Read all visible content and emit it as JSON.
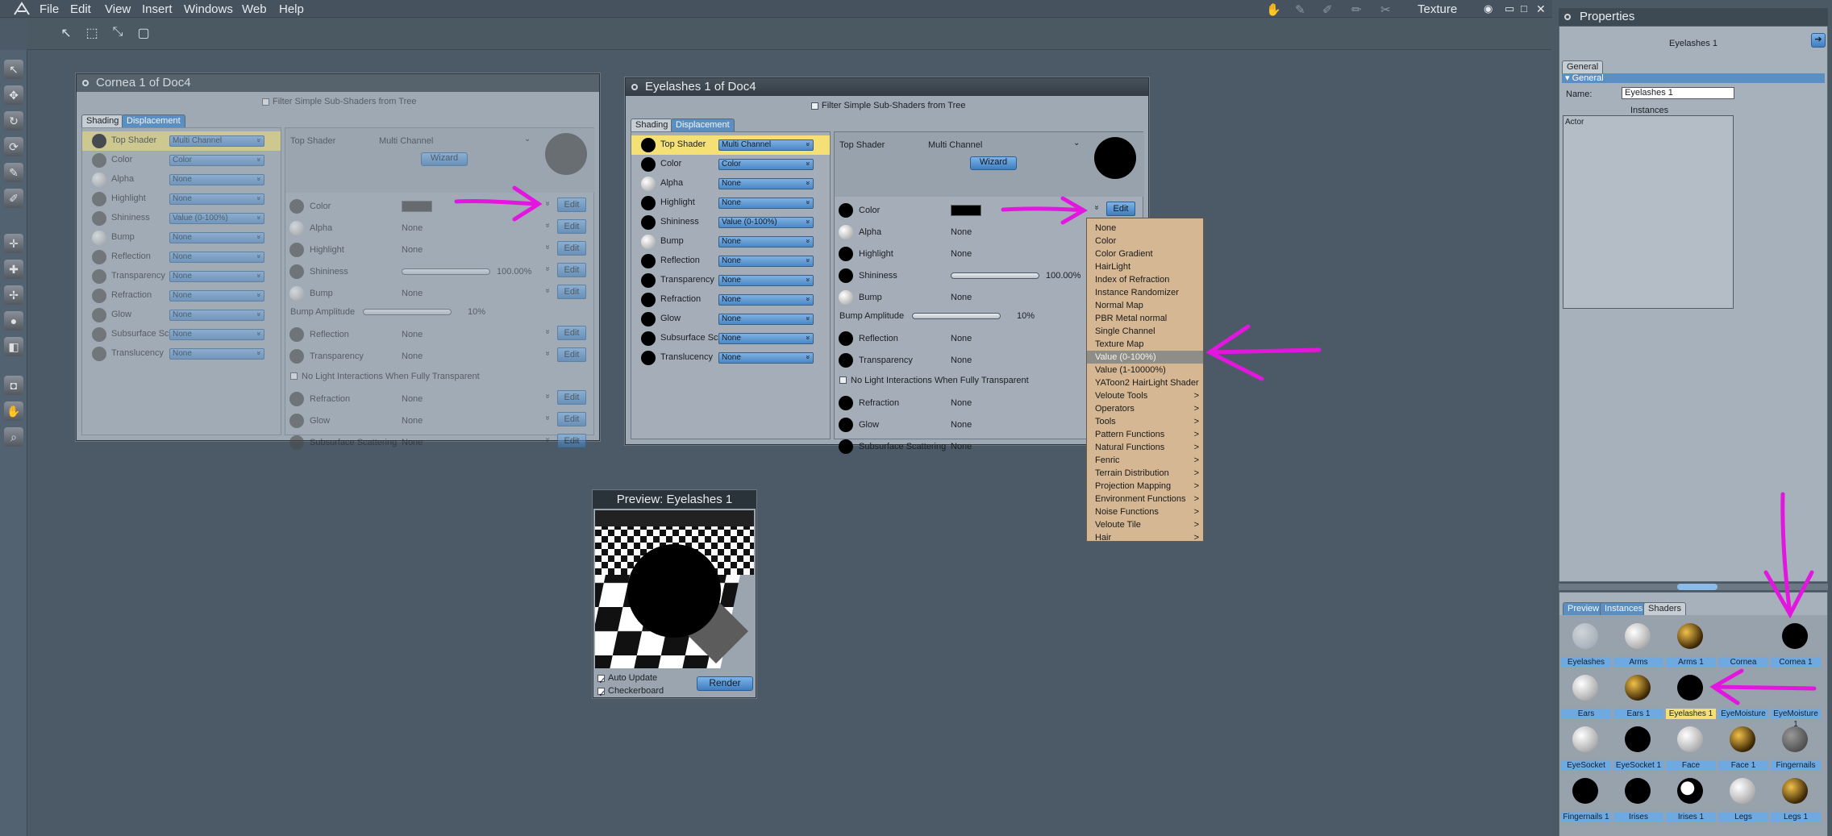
{
  "menubar": {
    "items": [
      "File",
      "Edit",
      "View",
      "Insert",
      "Windows",
      "Web",
      "Help"
    ],
    "room": "Texture"
  },
  "cornea_window": {
    "title": "Cornea 1 of Doc4",
    "filter_label": "Filter Simple Sub-Shaders from Tree",
    "tabs": [
      "Shading",
      "Displacement"
    ],
    "tree": [
      {
        "label": "Top Shader",
        "value": "Multi Channel"
      },
      {
        "label": "Color",
        "value": "Color"
      },
      {
        "label": "Alpha",
        "value": "None"
      },
      {
        "label": "Highlight",
        "value": "None"
      },
      {
        "label": "Shininess",
        "value": "Value (0-100%)"
      },
      {
        "label": "Bump",
        "value": "None"
      },
      {
        "label": "Reflection",
        "value": "None"
      },
      {
        "label": "Transparency",
        "value": "None"
      },
      {
        "label": "Refraction",
        "value": "None"
      },
      {
        "label": "Glow",
        "value": "None"
      },
      {
        "label": "Subsurface Sc",
        "value": "None"
      },
      {
        "label": "Translucency",
        "value": "None"
      }
    ],
    "top_shader_label": "Top Shader",
    "top_shader_value": "Multi Channel",
    "wizard": "Wizard",
    "props": [
      {
        "label": "Color",
        "value": ""
      },
      {
        "label": "Alpha",
        "value": "None"
      },
      {
        "label": "Highlight",
        "value": "None"
      },
      {
        "label": "Shininess",
        "value": "100.00%"
      },
      {
        "label": "Bump",
        "value": "None"
      }
    ],
    "bump_amplitude_label": "Bump Amplitude",
    "bump_amplitude_value": "10%",
    "props2": [
      {
        "label": "Reflection",
        "value": "None"
      },
      {
        "label": "Transparency",
        "value": "None"
      }
    ],
    "no_light_label": "No Light Interactions When Fully Transparent",
    "props3": [
      {
        "label": "Refraction",
        "value": "None"
      },
      {
        "label": "Glow",
        "value": "None"
      },
      {
        "label": "Subsurface Scattering",
        "value": "None"
      }
    ],
    "edit": "Edit"
  },
  "eyelashes_window": {
    "title": "Eyelashes 1 of Doc4",
    "filter_label": "Filter Simple Sub-Shaders from Tree",
    "tabs": [
      "Shading",
      "Displacement"
    ],
    "tree": [
      {
        "label": "Top Shader",
        "value": "Multi Channel"
      },
      {
        "label": "Color",
        "value": "Color"
      },
      {
        "label": "Alpha",
        "value": "None"
      },
      {
        "label": "Highlight",
        "value": "None"
      },
      {
        "label": "Shininess",
        "value": "Value (0-100%)"
      },
      {
        "label": "Bump",
        "value": "None"
      },
      {
        "label": "Reflection",
        "value": "None"
      },
      {
        "label": "Transparency",
        "value": "None"
      },
      {
        "label": "Refraction",
        "value": "None"
      },
      {
        "label": "Glow",
        "value": "None"
      },
      {
        "label": "Subsurface Sc",
        "value": "None"
      },
      {
        "label": "Translucency",
        "value": "None"
      }
    ],
    "top_shader_label": "Top Shader",
    "top_shader_value": "Multi Channel",
    "wizard": "Wizard",
    "props": [
      {
        "label": "Color",
        "value": ""
      },
      {
        "label": "Alpha",
        "value": "None"
      },
      {
        "label": "Highlight",
        "value": "None"
      },
      {
        "label": "Shininess",
        "value": "100.00%"
      },
      {
        "label": "Bump",
        "value": "None"
      }
    ],
    "bump_amplitude_label": "Bump Amplitude",
    "bump_amplitude_value": "10%",
    "props2": [
      {
        "label": "Reflection",
        "value": "None"
      },
      {
        "label": "Transparency",
        "value": "None"
      }
    ],
    "no_light_label": "No Light Interactions When Fully Transparent",
    "props3": [
      {
        "label": "Refraction",
        "value": "None"
      },
      {
        "label": "Glow",
        "value": "None"
      },
      {
        "label": "Subsurface Scattering",
        "value": "None"
      }
    ],
    "edit": "Edit"
  },
  "context_menu": {
    "items": [
      {
        "label": "None",
        "sub": false
      },
      {
        "label": "Color",
        "sub": false
      },
      {
        "label": "Color Gradient",
        "sub": false
      },
      {
        "label": "HairLight",
        "sub": false
      },
      {
        "label": "Index of Refraction",
        "sub": false
      },
      {
        "label": "Instance Randomizer",
        "sub": false
      },
      {
        "label": "Normal Map",
        "sub": false
      },
      {
        "label": "PBR Metal normal",
        "sub": false
      },
      {
        "label": "Single Channel",
        "sub": false
      },
      {
        "label": "Texture Map",
        "sub": false
      },
      {
        "label": "Value (0-100%)",
        "sub": false,
        "highlighted": true
      },
      {
        "label": "Value (1-10000%)",
        "sub": false
      },
      {
        "label": "YAToon2 HairLight Shader",
        "sub": false
      },
      {
        "label": "Veloute Tools",
        "sub": true
      },
      {
        "label": "Operators",
        "sub": true
      },
      {
        "label": "Tools",
        "sub": true
      },
      {
        "label": "Pattern Functions",
        "sub": true
      },
      {
        "label": "Natural Functions",
        "sub": true
      },
      {
        "label": "Fenric",
        "sub": true
      },
      {
        "label": "Terrain Distribution",
        "sub": true
      },
      {
        "label": "Projection Mapping",
        "sub": true
      },
      {
        "label": "Environment Functions",
        "sub": true
      },
      {
        "label": "Noise Functions",
        "sub": true
      },
      {
        "label": "Veloute Tile",
        "sub": true
      },
      {
        "label": "Hair",
        "sub": true
      }
    ],
    "submenu_arrow": ">"
  },
  "preview": {
    "title": "Preview: Eyelashes 1",
    "auto_update": "Auto Update",
    "checkerboard": "Checkerboard",
    "render": "Render"
  },
  "properties": {
    "title": "Properties",
    "object_name": "Eyelashes 1",
    "tab": "General",
    "section": "General",
    "name_label": "Name:",
    "name_value": "Eyelashes 1",
    "instances_label": "Instances",
    "instances_list": [
      "Actor"
    ]
  },
  "browser": {
    "tabs": [
      "Preview",
      "Instances",
      "Shaders"
    ],
    "shaders": [
      {
        "name": "Eyelashes",
        "style": "faint"
      },
      {
        "name": "Arms",
        "style": "white"
      },
      {
        "name": "Arms 1",
        "style": "gold"
      },
      {
        "name": "Cornea",
        "style": "empty"
      },
      {
        "name": "Cornea 1",
        "style": "black"
      },
      {
        "name": "Ears",
        "style": "white"
      },
      {
        "name": "Ears 1",
        "style": "gold"
      },
      {
        "name": "Eyelashes 1",
        "style": "black",
        "selected": true
      },
      {
        "name": "EyeMoisture",
        "style": "empty"
      },
      {
        "name": "EyeMoisture 1",
        "style": "empty"
      },
      {
        "name": "EyeSocket",
        "style": "white"
      },
      {
        "name": "EyeSocket 1",
        "style": "black"
      },
      {
        "name": "Face",
        "style": "white"
      },
      {
        "name": "Face 1",
        "style": "gold"
      },
      {
        "name": "Fingernails",
        "style": "grey"
      },
      {
        "name": "Fingernails 1",
        "style": "black"
      },
      {
        "name": "Irises",
        "style": "black"
      },
      {
        "name": "Irises 1",
        "style": "eye"
      },
      {
        "name": "Legs",
        "style": "white"
      },
      {
        "name": "Legs 1",
        "style": "gold"
      }
    ]
  },
  "colors": {
    "annotation": "#e316e0",
    "accent_blue": "#5a8fc4",
    "menu_bg": "#d6b793",
    "selected_yellow": "#f4e074"
  }
}
